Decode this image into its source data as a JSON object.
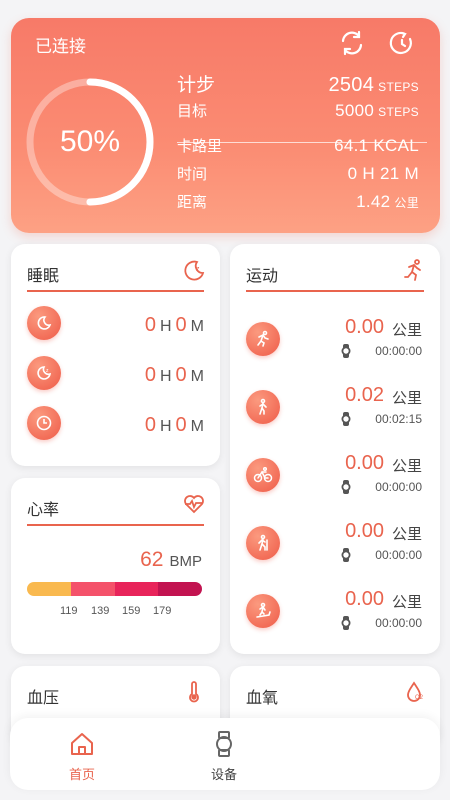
{
  "hero": {
    "status": "已连接",
    "percent": "50%",
    "percent_value": 0.5,
    "steps_label": "计步",
    "steps_value": "2504",
    "steps_unit": "STEPS",
    "goal_label": "目标",
    "goal_value": "5000",
    "goal_unit": "STEPS",
    "cal_label": "卡路里",
    "cal_value": "64.1 KCAL",
    "time_label": "时间",
    "time_value": "0 H 21 M",
    "dist_label": "距离",
    "dist_value": "1.42",
    "dist_unit": "公里"
  },
  "sleep": {
    "title": "睡眠",
    "rows": [
      {
        "h": "0",
        "m": "0",
        "hu": "H",
        "mu": "M"
      },
      {
        "h": "0",
        "m": "0",
        "hu": "H",
        "mu": "M"
      },
      {
        "h": "0",
        "m": "0",
        "hu": "H",
        "mu": "M"
      }
    ]
  },
  "sport": {
    "title": "运动",
    "items": [
      {
        "dist": "0.00",
        "unit": "公里",
        "time": "00:00:00"
      },
      {
        "dist": "0.02",
        "unit": "公里",
        "time": "00:02:15"
      },
      {
        "dist": "0.00",
        "unit": "公里",
        "time": "00:00:00"
      },
      {
        "dist": "0.00",
        "unit": "公里",
        "time": "00:00:00"
      },
      {
        "dist": "0.00",
        "unit": "公里",
        "time": "00:00:00"
      }
    ]
  },
  "heart": {
    "title": "心率",
    "value": "62",
    "unit": "BMP",
    "ticks": [
      "119",
      "139",
      "159",
      "179"
    ],
    "zone_colors": [
      "#f9b94f",
      "#f4526a",
      "#e8245a",
      "#c21350"
    ]
  },
  "bp": {
    "title": "血压"
  },
  "oxygen": {
    "title": "血氧"
  },
  "tabs": {
    "home": "首页",
    "device": "设备"
  },
  "colors": {
    "accent": "#e9644e",
    "tab_active": "#e9644e",
    "tab_inactive": "#555555"
  }
}
